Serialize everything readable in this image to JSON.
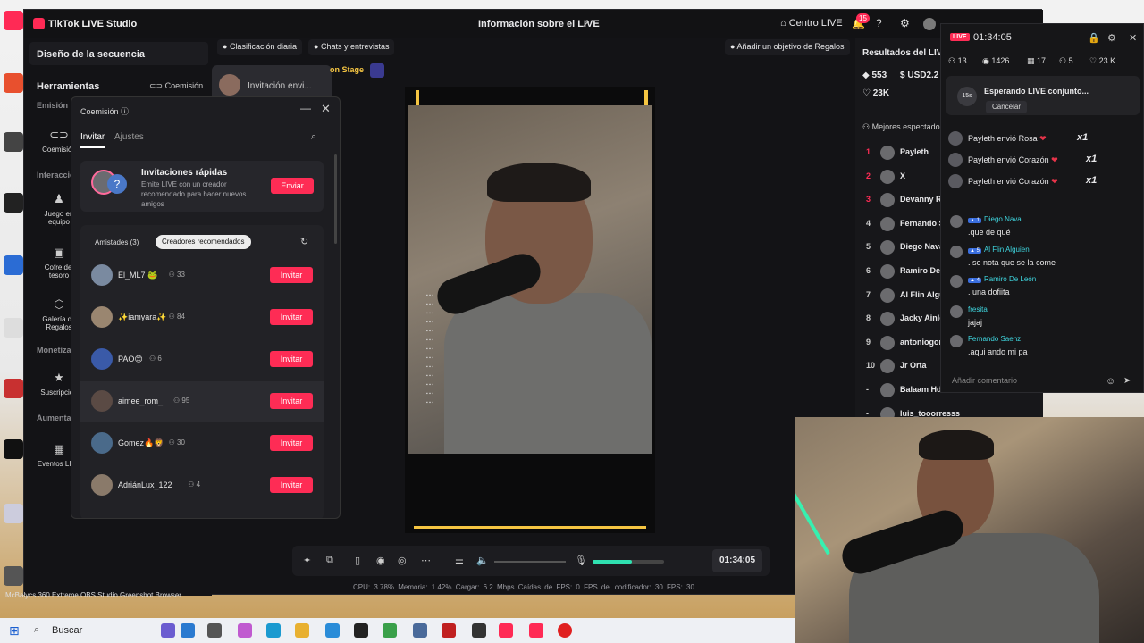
{
  "window": {
    "app_title": "TikTok LIVE Studio",
    "center_title": "Información sobre el LIVE",
    "centro_label": "Centro LIVE",
    "notif_count": "15"
  },
  "left": {
    "sequence_design": "Diseño de la secuencia",
    "tools": "Herramientas",
    "comision": "Coemisión",
    "sections": [
      "Emisión LIVE conjunta",
      "Interacción",
      "Monetización",
      "Aumentar"
    ],
    "items": [
      {
        "label": "Coemisión"
      },
      {
        "label": "Juego en equipo"
      },
      {
        "label": "Cofre del tesoro"
      },
      {
        "label": "Galería de Regalos"
      },
      {
        "label": "Suscripción"
      },
      {
        "label": "Eventos LIVE"
      }
    ]
  },
  "toolbar": {
    "clasificacion": "Clasificación diaria",
    "chats": "Chats y entrevistas",
    "gift_goal": "Añadir un objetivo de Regalos",
    "invite_peek": "Invitación envi...",
    "on_stage": "on Stage"
  },
  "modal": {
    "title": "Coemisión",
    "tabs": [
      "Invitar",
      "Ajustes"
    ],
    "quick_title": "Invitaciones rápidas",
    "quick_desc": "Emite LIVE con un creador recomendado para hacer nuevos amigos",
    "send_label": "Enviar",
    "seg_friends": "Amistades (3)",
    "seg_recommended": "Creadores recomendados",
    "invite_label": "Invitar",
    "creators": [
      {
        "name": "El_ML7 🐸",
        "count": "33",
        "color": "#7a8aa0"
      },
      {
        "name": "✨iamyara✨",
        "count": "84",
        "color": "#9a8670"
      },
      {
        "name": "PAO😊",
        "count": "6",
        "color": "#3a5aa8"
      },
      {
        "name": "aimee_rom_",
        "count": "95",
        "color": "#5a4a44"
      },
      {
        "name": "Gomez🔥🦁",
        "count": "30",
        "color": "#4a6a8a"
      },
      {
        "name": "AdriánLux_122",
        "count": "4",
        "color": "#8a7a6a"
      }
    ]
  },
  "controls": {
    "timer": "01:34:05",
    "stats": "CPU: 3.78%   Memoria: 1.42%   Cargar: 6.2 Mbps   Caídas de FPS: 0   FPS del codificador: 30   FPS: 30"
  },
  "results": {
    "title": "Resultados del LIVE",
    "coins": "553",
    "usd": "USD2.2",
    "likes": "23K",
    "best_label": "Mejores espectadores",
    "viewers": [
      {
        "rank": "1",
        "name": "Payleth"
      },
      {
        "rank": "2",
        "name": "X"
      },
      {
        "rank": "3",
        "name": "Devanny Rl"
      },
      {
        "rank": "4",
        "name": "Fernando S"
      },
      {
        "rank": "5",
        "name": "Diego Nava"
      },
      {
        "rank": "6",
        "name": "Ramiro De L"
      },
      {
        "rank": "7",
        "name": "Al Flin Algu"
      },
      {
        "rank": "8",
        "name": "Jacky Ainle"
      },
      {
        "rank": "9",
        "name": "antoniogon"
      },
      {
        "rank": "10",
        "name": "Jr Orta"
      },
      {
        "rank": "-",
        "name": "Balaam Hd"
      },
      {
        "rank": "-",
        "name": "luis_tooorresss"
      }
    ]
  },
  "overlay": {
    "live": "LIVE",
    "time": "01:34:05",
    "stats": [
      "13",
      "1426",
      "17",
      "5",
      "23 K"
    ],
    "waiting": "Esperando LIVE conjunto...",
    "countdown": "15s",
    "cancel": "Cancelar",
    "gifts": [
      {
        "user": "Payleth",
        "text": "envió Rosa",
        "mult": "x1"
      },
      {
        "user": "Payleth",
        "text": "envió Corazón",
        "mult": "x1"
      },
      {
        "user": "Payleth",
        "text": "envió Corazón",
        "mult": "x1"
      }
    ],
    "comments": [
      {
        "level": "1",
        "user": "Diego Nava",
        "text": ".que de qué"
      },
      {
        "level": "5",
        "user": "Al Flin Alguien",
        "text": ". se nota que se la come"
      },
      {
        "level": "4",
        "user": "Ramiro De León",
        "text": ". una dofiita"
      },
      {
        "level": "",
        "user": "fresita",
        "text": "jajaj"
      },
      {
        "level": "",
        "user": "Fernando Saenz",
        "text": ".aqui ando mi pa"
      }
    ],
    "input_placeholder": "Añadir comentario"
  },
  "taskbar": {
    "search": "Buscar",
    "below": "McBalycs   360 Extreme   OBS Studio   Greenshot   Browser"
  },
  "colors": {
    "accent": "#fe2c55",
    "mic_level": "#2fe0b0",
    "name_cyan": "#3fd7e0"
  }
}
